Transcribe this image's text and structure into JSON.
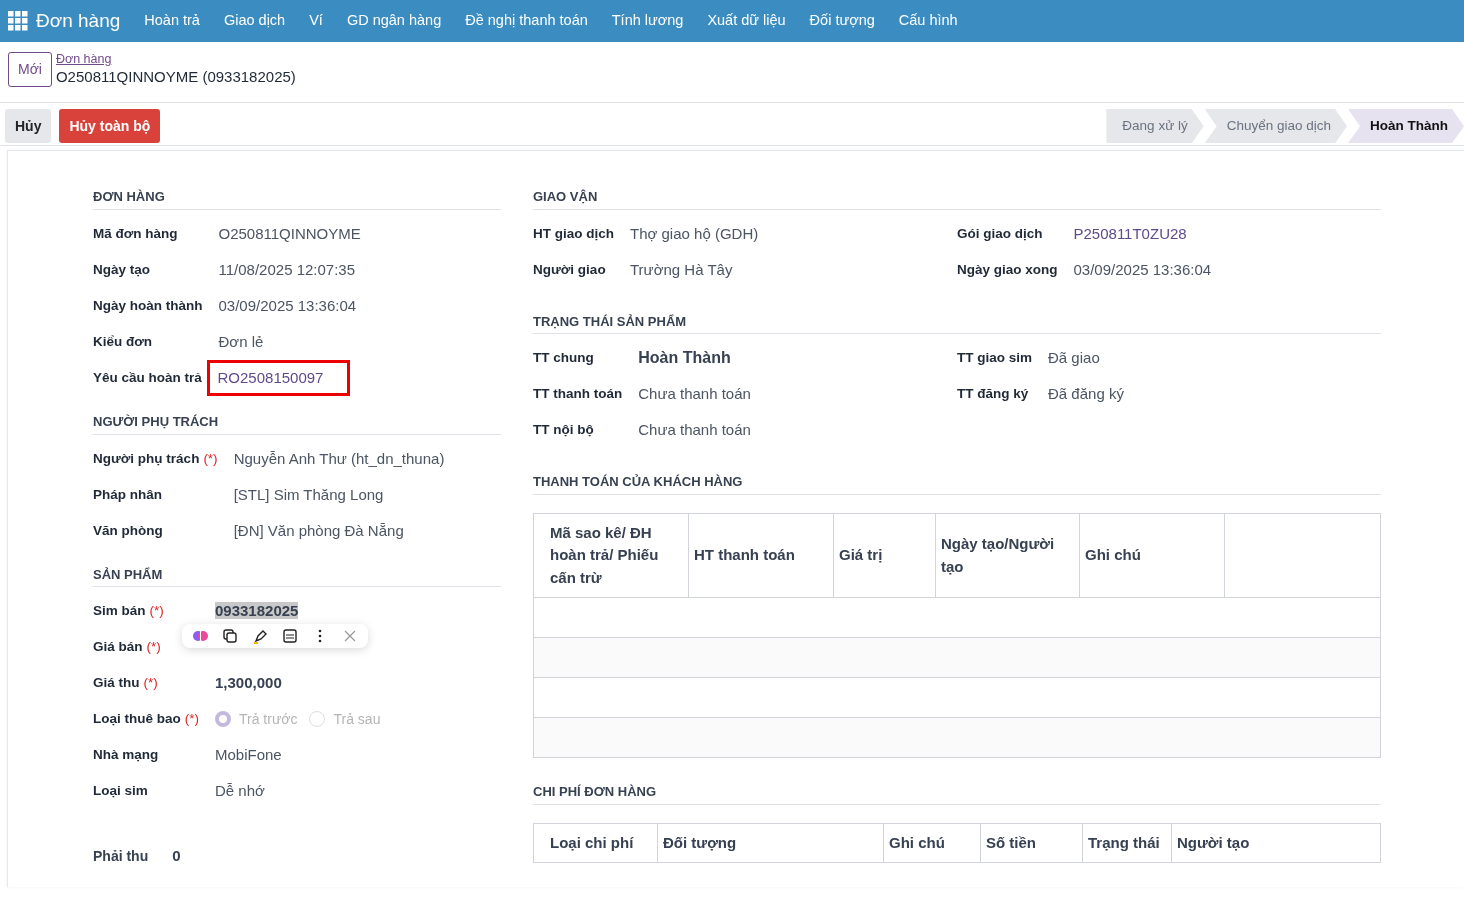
{
  "navbar": {
    "app": "Đơn hàng",
    "menus": [
      "Hoàn trả",
      "Giao dịch",
      "Ví",
      "GD ngân hàng",
      "Đề nghị thanh toán",
      "Tính lương",
      "Xuất dữ liệu",
      "Đối tượng",
      "Cấu hình"
    ]
  },
  "breadcrumb": {
    "new_button": "Mới",
    "parent": "Đơn hàng",
    "title": "O250811QINNOYME (0933182025)"
  },
  "actions": [
    {
      "label": "Hủy",
      "kind": "secondary"
    },
    {
      "label": "Hủy toàn bộ",
      "kind": "danger"
    }
  ],
  "stages": [
    {
      "label": "Đang xử lý",
      "selected": false
    },
    {
      "label": "Chuyển giao dịch",
      "selected": false
    },
    {
      "label": "Hoàn Thành",
      "selected": true
    }
  ],
  "left_sections": [
    {
      "title": "ĐƠN HÀNG",
      "fields": [
        {
          "label": "Mã đơn hàng",
          "kind": "text",
          "value": "O250811QINNOYME"
        },
        {
          "label": "Ngày tạo",
          "kind": "text",
          "value": "11/08/2025 12:07:35"
        },
        {
          "label": "Ngày hoàn thành",
          "kind": "text",
          "value": "03/09/2025 13:36:04"
        },
        {
          "label": "Kiểu đơn",
          "kind": "text",
          "value": "Đơn lẻ"
        },
        {
          "label": "Yêu cầu hoàn trả",
          "kind": "link",
          "value": "RO2508150097",
          "highlighted": true
        }
      ]
    },
    {
      "title": "NGƯỜI PHỤ TRÁCH",
      "fields": [
        {
          "label": "Người phụ trách",
          "required": "(*)",
          "kind": "text",
          "value": "Nguyễn Anh Thư (ht_dn_thuna)"
        },
        {
          "label": "Pháp nhân",
          "kind": "text",
          "value": "[STL] Sim Thăng Long"
        },
        {
          "label": "Văn phòng",
          "kind": "text",
          "value": "[ĐN] Văn phòng Đà Nẵng"
        }
      ]
    },
    {
      "title": "SẢN PHẨM",
      "fields": [
        {
          "label": "Sim bán",
          "required": "(*)",
          "kind": "bold",
          "value": "0933182025",
          "highlighted": true
        },
        {
          "label": "Giá bán",
          "required": "(*)",
          "kind": "bold"
        },
        {
          "label": "Giá thu",
          "required": "(*)",
          "kind": "bold",
          "value": "1,300,000"
        },
        {
          "label": "Loại thuê bao",
          "required": "(*)",
          "kind": "radio",
          "options": [
            {
              "label": "Trả trước",
              "selected": true
            },
            {
              "label": "Trả sau",
              "selected": false
            }
          ]
        },
        {
          "label": "Nhà mạng",
          "kind": "text",
          "value": "MobiFone"
        },
        {
          "label": "Loại sim",
          "kind": "text",
          "value": "Dễ nhớ"
        }
      ]
    }
  ],
  "receivable": {
    "label": "Phải thu",
    "value": "0"
  },
  "delivery": {
    "title": "GIAO VẬN",
    "left": [
      {
        "label": "HT giao dịch",
        "kind": "text",
        "value": "Thợ giao hộ (GDH)"
      },
      {
        "label": "Người giao",
        "kind": "text",
        "value": "Trường Hà Tây"
      }
    ],
    "right": [
      {
        "label": "Gói giao dịch",
        "kind": "link",
        "value": "P250811T0ZU28"
      },
      {
        "label": "Ngày giao xong",
        "kind": "text",
        "value": "03/09/2025 13:36:04"
      }
    ]
  },
  "product_status": {
    "title": "TRẠNG THÁI SẢN PHẨM",
    "left": [
      {
        "label": "TT chung",
        "kind": "strong",
        "value": "Hoàn Thành"
      },
      {
        "label": "TT thanh toán",
        "kind": "text",
        "value": "Chưa thanh toán"
      },
      {
        "label": "TT nội bộ",
        "kind": "text",
        "value": "Chưa thanh toán"
      }
    ],
    "right": [
      {
        "label": "TT giao sim",
        "kind": "text",
        "value": "Đã giao"
      },
      {
        "label": "TT đăng ký",
        "kind": "text",
        "value": "Đã đăng ký"
      }
    ]
  },
  "payments": {
    "title": "THANH TOÁN CỦA KHÁCH HÀNG",
    "columns": [
      "Mã sao kê/ ĐH hoàn trả/ Phiếu cấn trừ",
      "HT thanh toán",
      "Giá trị",
      "Ngày tạo/Người tạo",
      "Ghi chú"
    ]
  },
  "costs": {
    "title": "CHI PHÍ ĐƠN HÀNG",
    "columns": [
      "Loại chi phí",
      "Đối tượng",
      "Ghi chú",
      "Số tiền",
      "Trạng thái",
      "Người tạo"
    ]
  }
}
